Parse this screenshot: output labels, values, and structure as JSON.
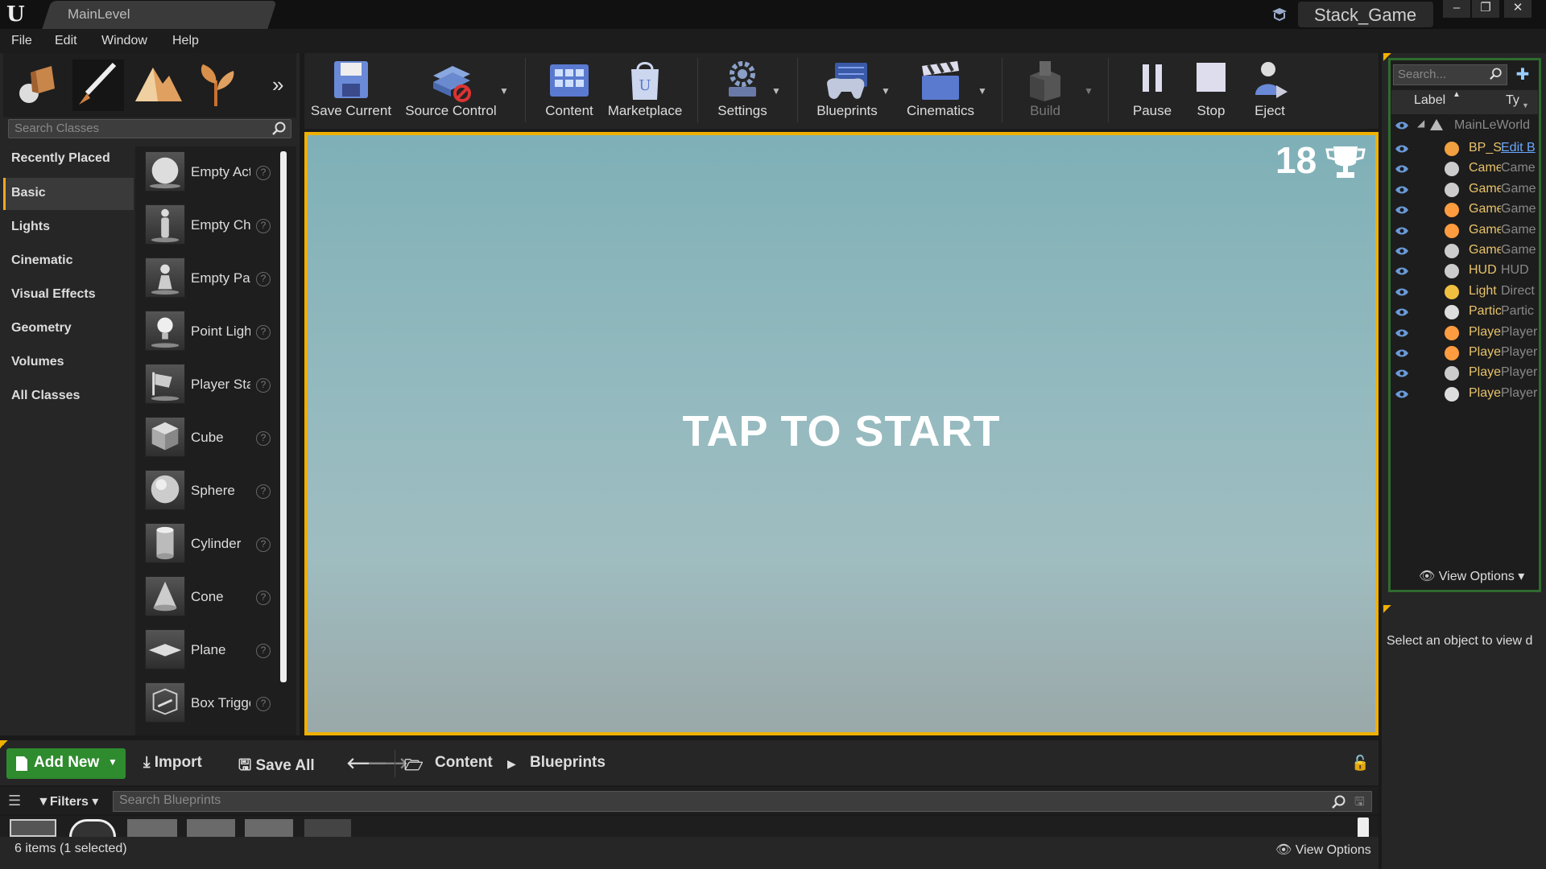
{
  "window": {
    "tab_label": "MainLevel",
    "project_name": "Stack_Game",
    "buttons": [
      "–",
      "❐",
      "✕"
    ]
  },
  "menu": [
    "File",
    "Edit",
    "Window",
    "Help"
  ],
  "place_panel": {
    "search_placeholder": "Search Classes",
    "categories": [
      "Recently Placed",
      "Basic",
      "Lights",
      "Cinematic",
      "Visual Effects",
      "Geometry",
      "Volumes",
      "All Classes"
    ],
    "selected_category": "Basic",
    "classes": [
      "Empty Actor",
      "Empty Character",
      "Empty Pawn",
      "Point Light",
      "Player Start",
      "Cube",
      "Sphere",
      "Cylinder",
      "Cone",
      "Plane",
      "Box Trigger"
    ]
  },
  "toolbar": {
    "save_current": "Save Current",
    "source_control": "Source Control",
    "content": "Content",
    "marketplace": "Marketplace",
    "settings": "Settings",
    "blueprints": "Blueprints",
    "cinematics": "Cinematics",
    "build": "Build",
    "pause": "Pause",
    "stop": "Stop",
    "eject": "Eject"
  },
  "viewport": {
    "score": "18",
    "tap_text": "TAP TO START"
  },
  "outliner": {
    "search_placeholder": "Search...",
    "col_label": "Label",
    "col_type": "Ty",
    "world": "MainLeWorld",
    "rows": [
      {
        "label": "BP_S",
        "type": "Edit B"
      },
      {
        "label": "Came",
        "type": "Came"
      },
      {
        "label": "Game",
        "type": "Game"
      },
      {
        "label": "Game",
        "type": "Game"
      },
      {
        "label": "Game",
        "type": "Game"
      },
      {
        "label": "Game",
        "type": "Game"
      },
      {
        "label": "HUD",
        "type": "HUD"
      },
      {
        "label": "Light",
        "type": "Direct"
      },
      {
        "label": "Partic",
        "type": "Partic"
      },
      {
        "label": "Playe",
        "type": "Player"
      },
      {
        "label": "Playe",
        "type": "Player"
      },
      {
        "label": "Playe",
        "type": "Player"
      },
      {
        "label": "Playe",
        "type": "Player"
      }
    ],
    "view_options": "View Options",
    "details_text": "Select an object to view d"
  },
  "content_browser": {
    "add_new": "Add New",
    "import": "Import",
    "save_all": "Save All",
    "path_root": "Content",
    "path_current": "Blueprints",
    "filters": "Filters",
    "search_placeholder": "Search Blueprints",
    "items_count": "6 items (1 selected)",
    "view_options": "View Options"
  }
}
